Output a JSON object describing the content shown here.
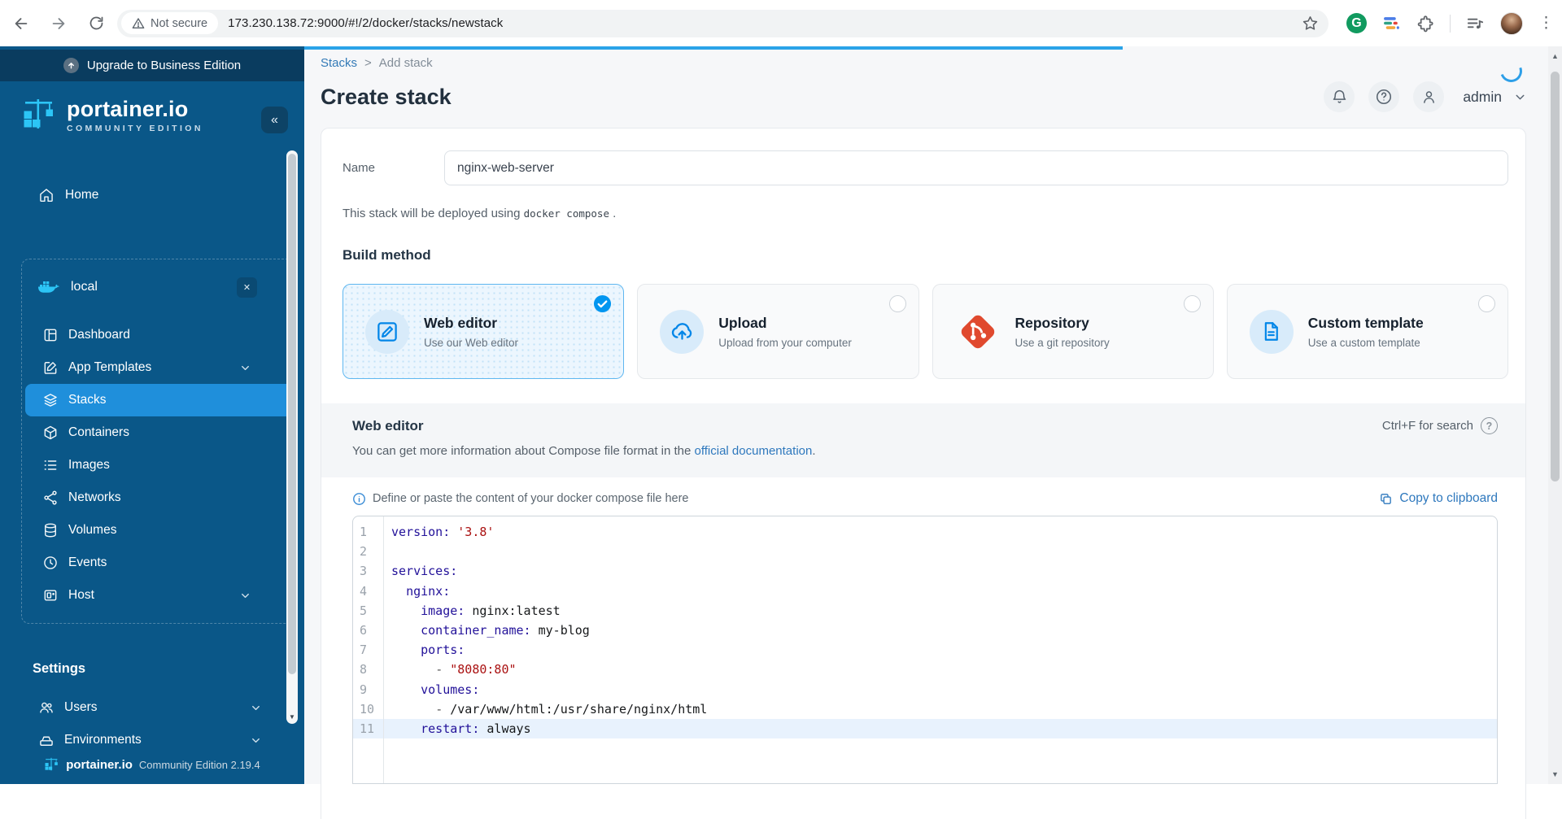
{
  "browser": {
    "not_secure_label": "Not secure",
    "url": "173.230.138.72:9000/#!/2/docker/stacks/newstack"
  },
  "icons": {
    "collapse": "«",
    "close": "✕",
    "help": "?",
    "grammarly": "G",
    "menu_dots": "⋮",
    "scroll_up": "▲",
    "scroll_down": "▼"
  },
  "sidebar": {
    "upgrade_banner": "Upgrade to Business Edition",
    "logo_text": "portainer.io",
    "logo_subtext": "COMMUNITY EDITION",
    "home_label": "Home",
    "endpoint": {
      "name": "local"
    },
    "items": [
      {
        "label": "Dashboard"
      },
      {
        "label": "App Templates",
        "expandable": true
      },
      {
        "label": "Stacks",
        "selected": true
      },
      {
        "label": "Containers"
      },
      {
        "label": "Images"
      },
      {
        "label": "Networks"
      },
      {
        "label": "Volumes"
      },
      {
        "label": "Events"
      },
      {
        "label": "Host",
        "expandable": true
      }
    ],
    "settings_heading": "Settings",
    "settings_items": [
      {
        "label": "Users",
        "expandable": true
      },
      {
        "label": "Environments",
        "expandable": true
      }
    ],
    "footer_brand": "portainer.io",
    "footer_edition": "Community Edition 2.19.4"
  },
  "header": {
    "breadcrumb": {
      "link": "Stacks",
      "separator": ">",
      "current": "Add stack"
    },
    "title": "Create stack",
    "user": "admin"
  },
  "form": {
    "name_label": "Name",
    "name_value": "nginx-web-server",
    "deploy_prefix": "This stack will be deployed using",
    "deploy_code": "docker compose",
    "deploy_suffix": "."
  },
  "build_method": {
    "heading": "Build method",
    "cards": [
      {
        "title": "Web editor",
        "subtitle": "Use our Web editor",
        "icon": "pencil-square-icon",
        "selected": true
      },
      {
        "title": "Upload",
        "subtitle": "Upload from your computer",
        "icon": "cloud-upload-icon",
        "selected": false
      },
      {
        "title": "Repository",
        "subtitle": "Use a git repository",
        "icon": "git-icon",
        "selected": false
      },
      {
        "title": "Custom template",
        "subtitle": "Use a custom template",
        "icon": "file-text-icon",
        "selected": false
      }
    ]
  },
  "web_editor": {
    "heading": "Web editor",
    "search_hint": "Ctrl+F for search",
    "info_prefix": "You can get more information about Compose file format in the ",
    "info_link": "official documentation",
    "info_suffix": ".",
    "instruction": "Define or paste the content of your docker compose file here",
    "copy_label": "Copy to clipboard"
  },
  "editor": {
    "lines": [
      {
        "num": 1,
        "tokens": [
          {
            "s": "key",
            "t": "version:"
          },
          {
            "s": "plain",
            "t": " "
          },
          {
            "s": "str",
            "t": "'3.8'"
          }
        ]
      },
      {
        "num": 2,
        "tokens": []
      },
      {
        "num": 3,
        "tokens": [
          {
            "s": "key",
            "t": "services:"
          }
        ]
      },
      {
        "num": 4,
        "tokens": [
          {
            "s": "plain",
            "t": "  "
          },
          {
            "s": "key",
            "t": "nginx:"
          }
        ]
      },
      {
        "num": 5,
        "tokens": [
          {
            "s": "plain",
            "t": "    "
          },
          {
            "s": "key",
            "t": "image:"
          },
          {
            "s": "plain",
            "t": " nginx:latest"
          }
        ]
      },
      {
        "num": 6,
        "tokens": [
          {
            "s": "plain",
            "t": "    "
          },
          {
            "s": "key",
            "t": "container_name:"
          },
          {
            "s": "plain",
            "t": " my-blog"
          }
        ]
      },
      {
        "num": 7,
        "tokens": [
          {
            "s": "plain",
            "t": "    "
          },
          {
            "s": "key",
            "t": "ports:"
          }
        ]
      },
      {
        "num": 8,
        "tokens": [
          {
            "s": "plain",
            "t": "      "
          },
          {
            "s": "dash",
            "t": "-"
          },
          {
            "s": "plain",
            "t": " "
          },
          {
            "s": "str",
            "t": "\"8080:80\""
          }
        ]
      },
      {
        "num": 9,
        "tokens": [
          {
            "s": "plain",
            "t": "    "
          },
          {
            "s": "key",
            "t": "volumes:"
          }
        ]
      },
      {
        "num": 10,
        "tokens": [
          {
            "s": "plain",
            "t": "      "
          },
          {
            "s": "dash",
            "t": "-"
          },
          {
            "s": "plain",
            "t": " /var/www/html:/usr/share/nginx/html"
          }
        ]
      },
      {
        "num": 11,
        "active": true,
        "tokens": [
          {
            "s": "plain",
            "t": "    "
          },
          {
            "s": "key",
            "t": "restart:"
          },
          {
            "s": "plain",
            "t": " always"
          }
        ]
      }
    ]
  },
  "colors": {
    "accent_blue": "#0286e8",
    "sidebar_bg": "#0a5788",
    "selected_item_bg": "#1f8fdb",
    "git_orange": "#e0492e",
    "progress_bar": "#2aa3e8",
    "syntax_key": "#221199",
    "syntax_string": "#aa1111",
    "active_line_bg": "#e8f2fd"
  }
}
